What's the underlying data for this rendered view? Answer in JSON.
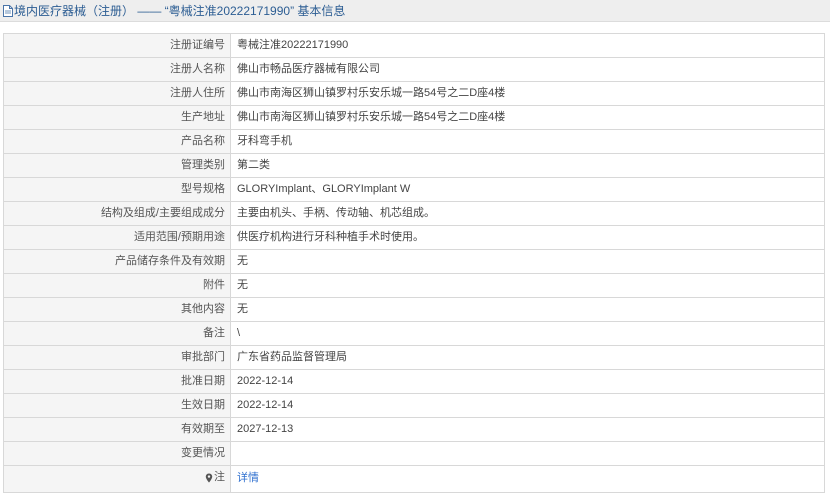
{
  "header": {
    "title": "境内医疗器械（注册） —— “粤械注准20222171990” 基本信息",
    "icon": "document-icon"
  },
  "rows": [
    {
      "label": "注册证编号",
      "value": "粤械注准20222171990"
    },
    {
      "label": "注册人名称",
      "value": "佛山市畅品医疗器械有限公司"
    },
    {
      "label": "注册人住所",
      "value": "佛山市南海区狮山镇罗村乐安乐城一路54号之二D座4楼"
    },
    {
      "label": "生产地址",
      "value": "佛山市南海区狮山镇罗村乐安乐城一路54号之二D座4楼"
    },
    {
      "label": "产品名称",
      "value": "牙科弯手机"
    },
    {
      "label": "管理类别",
      "value": "第二类"
    },
    {
      "label": "型号规格",
      "value": "GLORYImplant、GLORYImplant W"
    },
    {
      "label": "结构及组成/主要组成成分",
      "value": "主要由机头、手柄、传动轴、机芯组成。"
    },
    {
      "label": "适用范围/预期用途",
      "value": "供医疗机构进行牙科种植手术时使用。"
    },
    {
      "label": "产品储存条件及有效期",
      "value": "无"
    },
    {
      "label": "附件",
      "value": "无"
    },
    {
      "label": "其他内容",
      "value": "无"
    },
    {
      "label": "备注",
      "value": "\\"
    },
    {
      "label": "审批部门",
      "value": "广东省药品监督管理局"
    },
    {
      "label": "批准日期",
      "value": "2022-12-14"
    },
    {
      "label": "生效日期",
      "value": "2022-12-14"
    },
    {
      "label": "有效期至",
      "value": "2027-12-13"
    },
    {
      "label": "变更情况",
      "value": ""
    }
  ],
  "note_row": {
    "icon": "pin-icon",
    "label": "注",
    "link": "详情"
  },
  "colors": {
    "title": "#2c5d93",
    "link": "#2e6fcf",
    "label_bg": "#f5f5f5",
    "border": "#d8d8d8"
  }
}
